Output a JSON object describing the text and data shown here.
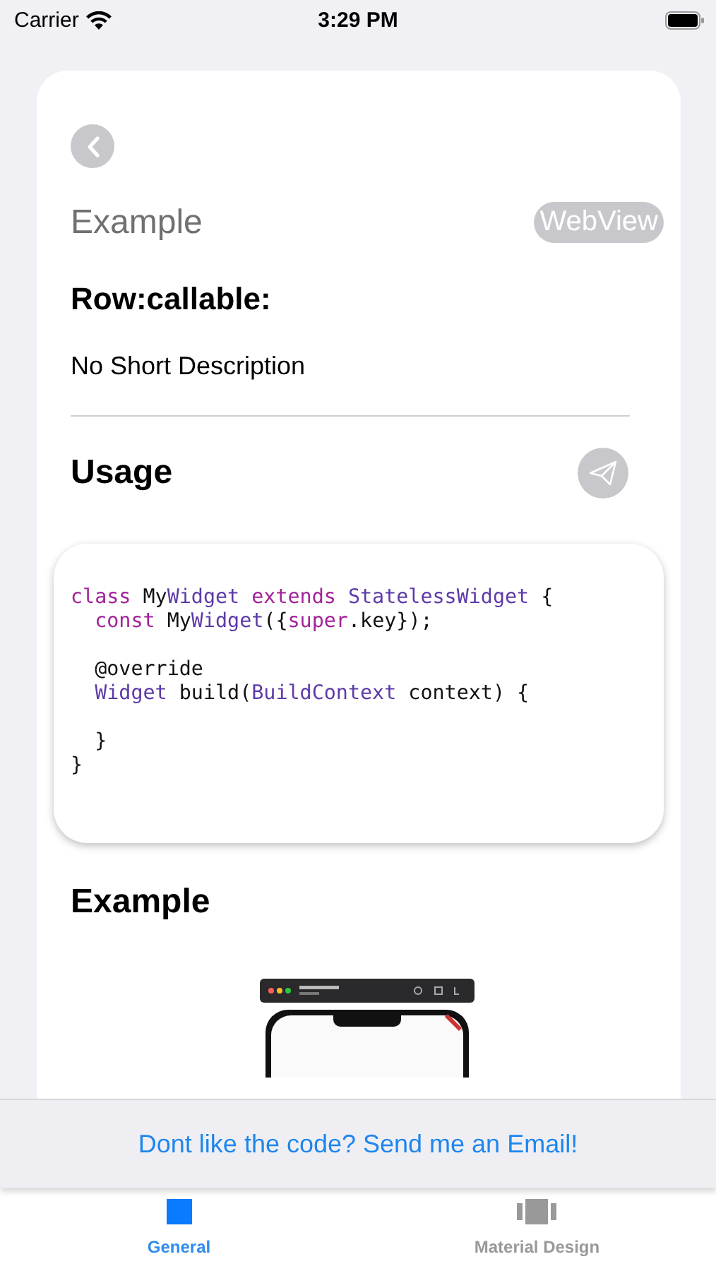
{
  "status_bar": {
    "carrier": "Carrier",
    "time": "3:29 PM"
  },
  "header": {
    "title": "Example",
    "badge": "WebView"
  },
  "widget": {
    "name": "Row:callable:",
    "description": "No Short Description"
  },
  "usage": {
    "title": "Usage"
  },
  "code_blocks": [
    [
      [
        {
          "text": "class",
          "kind": "keyword"
        },
        {
          "text": " My",
          "kind": "plain"
        },
        {
          "text": "Widget",
          "kind": "type"
        },
        {
          "text": " extends",
          "kind": "keyword"
        },
        {
          "text": " StatelessWidget",
          "kind": "type"
        },
        {
          "text": " {",
          "kind": "plain"
        }
      ],
      [
        {
          "text": "  const",
          "kind": "keyword"
        },
        {
          "text": " My",
          "kind": "plain"
        },
        {
          "text": "Widget",
          "kind": "type"
        },
        {
          "text": "({",
          "kind": "plain"
        },
        {
          "text": "super",
          "kind": "keyword"
        },
        {
          "text": ".key});",
          "kind": "plain"
        }
      ]
    ],
    [
      [
        {
          "text": "  @override",
          "kind": "plain"
        }
      ],
      [
        {
          "text": "  Widget",
          "kind": "type"
        },
        {
          "text": " build(",
          "kind": "plain"
        },
        {
          "text": "BuildContext",
          "kind": "type"
        },
        {
          "text": " context) {",
          "kind": "plain"
        }
      ]
    ],
    [
      [
        {
          "text": "  }",
          "kind": "plain"
        }
      ],
      [
        {
          "text": "}",
          "kind": "plain"
        }
      ]
    ]
  ],
  "example": {
    "title": "Example"
  },
  "banner": {
    "link": "Dont like the code? Send me an Email!"
  },
  "tabs": [
    {
      "label": "General",
      "selected": true,
      "kind": "square"
    },
    {
      "label": "Material Design",
      "selected": false,
      "kind": "carousel"
    }
  ]
}
